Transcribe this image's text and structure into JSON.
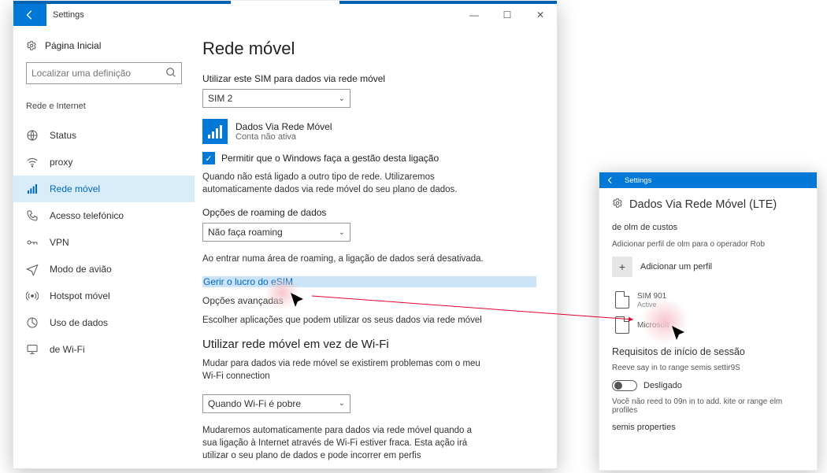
{
  "window": {
    "title": "Settings",
    "home": "Página Inicial",
    "search_placeholder": "Localizar uma definição",
    "nav_group": "Rede e Internet",
    "nav": [
      {
        "label": "Status"
      },
      {
        "label": "proxy"
      },
      {
        "label": "Rede móvel"
      },
      {
        "label": "Acesso telefónico"
      },
      {
        "label": "VPN"
      },
      {
        "label": "Modo de avião"
      },
      {
        "label": "Hotspot móvel"
      },
      {
        "label": "Uso de dados"
      },
      {
        "label": "de Wi-Fi"
      }
    ]
  },
  "content": {
    "heading": "Rede móvel",
    "sim_label": "Utilizar este SIM para dados via rede móvel",
    "sim_selected": "SIM 2",
    "network_name": "Dados Via Rede Móvel",
    "network_status": "Conta não ativa",
    "checkbox": "Permitir que o Windows faça a gestão desta ligação",
    "auto_desc": "Quando não está ligado a outro tipo de rede. Utilizaremos automaticamente dados via rede móvel do seu plano de dados.",
    "roaming_label": "Opções de roaming de dados",
    "roaming_selected": "Não faça roaming",
    "roaming_desc": "Ao entrar numa área de roaming, a ligação de dados será desativada.",
    "manage_link": "Gerir o lucro do eSIM",
    "advanced_link": "Opções avançadas",
    "apps_desc": "Escolher aplicações que podem utilizar os seus dados via rede móvel",
    "wifi_heading": "Utilizar rede móvel em vez de Wi-Fi",
    "wifi_desc": "Mudar para dados via rede móvel se existirem problemas com o meu Wi-Fi connection",
    "wifi_selected": "Quando Wi-Fi é pobre",
    "wifi_note": "Mudaremos automaticamente para dados via rede móvel quando a sua ligação à Internet através de Wi-Fi estiver fraca. Esta ação irá utilizar o seu plano de dados e pode incorrer em perfis"
  },
  "panel": {
    "title": "Settings",
    "heading": "Dados Via Rede Móvel (LTE)",
    "section1": "de olm de custos",
    "section1_sub": "Adicionar perfil de olm para o operador Rob",
    "add_label": "Adicionar um perfil",
    "sim1_name": "SIM 901",
    "sim1_status": "Active",
    "sim2_name": "Microsoft",
    "section2": "Requisitos de início de sessão",
    "section2_sub": "Reeve say in to range semis settir9S",
    "toggle_label": "Desligado",
    "note": "Você não reed to 09n in to add. kite or range elm profiles",
    "section3": "semis properties"
  }
}
